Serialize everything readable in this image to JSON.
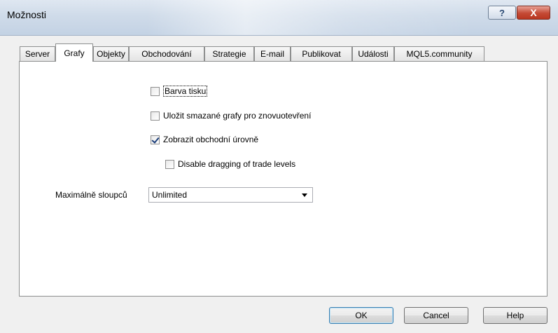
{
  "window": {
    "title": "Možnosti",
    "help_glyph": "?",
    "close_glyph": "X"
  },
  "tabs": [
    {
      "label": "Server"
    },
    {
      "label": "Grafy",
      "active": true
    },
    {
      "label": "Objekty"
    },
    {
      "label": "Obchodování"
    },
    {
      "label": "Strategie"
    },
    {
      "label": "E-mail"
    },
    {
      "label": "Publikovat"
    },
    {
      "label": "Události"
    },
    {
      "label": "MQL5.community"
    }
  ],
  "options": {
    "print_color": {
      "label": "Barva tisku",
      "checked": false
    },
    "save_deleted": {
      "label": "Uložit smazané grafy pro znovuotevření",
      "checked": false
    },
    "show_trade_levels": {
      "label": "Zobrazit obchodní úrovně",
      "checked": true
    },
    "disable_dragging": {
      "label": "Disable dragging of trade levels",
      "checked": false
    }
  },
  "max_bars": {
    "label": "Maximálně sloupců",
    "value": "Unlimited"
  },
  "buttons": {
    "ok": "OK",
    "cancel": "Cancel",
    "help": "Help"
  }
}
